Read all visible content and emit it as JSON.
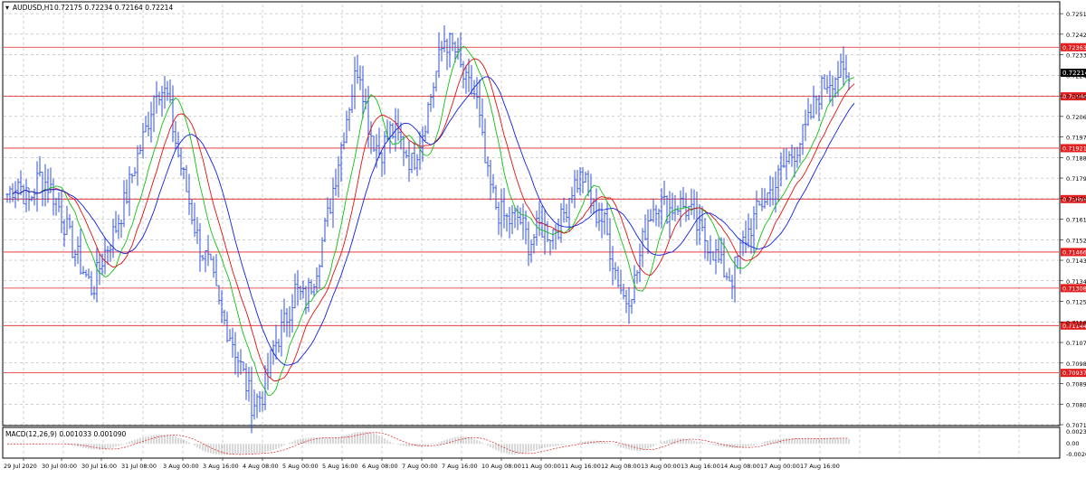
{
  "header": {
    "symbol_label": "AUDUSD,H1",
    "ohlc": "0.72175 0.72234 0.72164 0.72214"
  },
  "macd": {
    "label": "MACD(12,26,9) 0.001033 0.001090",
    "axis_labels": [
      "0.002315",
      "0.00",
      "-0.002090"
    ]
  },
  "price_axis": {
    "ticks": [
      "0.72510",
      "0.72420",
      "0.72330",
      "0.72240",
      "0.72150",
      "0.72060",
      "0.71970",
      "0.71880",
      "0.71790",
      "0.71700",
      "0.71610",
      "0.71520",
      "0.71430",
      "0.71340",
      "0.71250",
      "0.71160",
      "0.71070",
      "0.70980",
      "0.70890",
      "0.70800",
      "0.70710"
    ],
    "current_price": "0.72214"
  },
  "level_lines": [
    "0.72363",
    "0.72148",
    "0.71921",
    "0.71698",
    "0.71466",
    "0.71308",
    "0.71144",
    "0.70937"
  ],
  "time_axis": {
    "labels": [
      "29 Jul 2020",
      "30 Jul 00:00",
      "30 Jul 16:00",
      "31 Jul 08:00",
      "3 Aug 00:00",
      "3 Aug 16:00",
      "4 Aug 08:00",
      "5 Aug 00:00",
      "5 Aug 16:00",
      "6 Aug 08:00",
      "7 Aug 00:00",
      "7 Aug 16:00",
      "10 Aug 08:00",
      "11 Aug 00:00",
      "11 Aug 16:00",
      "12 Aug 08:00",
      "13 Aug 00:00",
      "13 Aug 16:00",
      "14 Aug 08:00",
      "17 Aug 00:00",
      "17 Aug 16:00"
    ]
  },
  "colors": {
    "background": "#ffffff",
    "grid": "#a0a0a0",
    "bars": "#3050e0",
    "level_line": "#e02020",
    "level_label_bg": "#e02020",
    "ma_fast": "#10c010",
    "ma_mid": "#e01010",
    "ma_slow": "#1020e0",
    "current_price_bg": "#000000",
    "macd_hist": "#a0a0a0",
    "macd_signal": "#e02020"
  },
  "chart_data": {
    "type": "ohlc-bar",
    "symbol": "AUDUSD",
    "timeframe": "H1",
    "ylim": [
      0.7071,
      0.7255
    ],
    "level_lines": [
      0.72363,
      0.72148,
      0.71921,
      0.71698,
      0.71466,
      0.71308,
      0.71144,
      0.70937
    ],
    "close_path": [
      0.7172,
      0.7178,
      0.7168,
      0.718,
      0.7175,
      0.7165,
      0.715,
      0.714,
      0.713,
      0.7145,
      0.7155,
      0.7168,
      0.7185,
      0.72,
      0.722,
      0.7215,
      0.719,
      0.717,
      0.715,
      0.714,
      0.712,
      0.711,
      0.7095,
      0.708,
      0.7085,
      0.7105,
      0.7115,
      0.713,
      0.7125,
      0.714,
      0.716,
      0.7185,
      0.721,
      0.723,
      0.72,
      0.719,
      0.72,
      0.7195,
      0.7185,
      0.72,
      0.722,
      0.724,
      0.7235,
      0.722,
      0.7215,
      0.718,
      0.7165,
      0.716,
      0.7162,
      0.715,
      0.7158,
      0.7155,
      0.716,
      0.7175,
      0.718,
      0.7165,
      0.716,
      0.714,
      0.7125,
      0.7135,
      0.716,
      0.717,
      0.7165,
      0.7168,
      0.7165,
      0.7155,
      0.715,
      0.714,
      0.7135,
      0.715,
      0.716,
      0.717,
      0.7175,
      0.7185,
      0.7192,
      0.72,
      0.7215,
      0.7222,
      0.7225,
      0.7221
    ]
  }
}
